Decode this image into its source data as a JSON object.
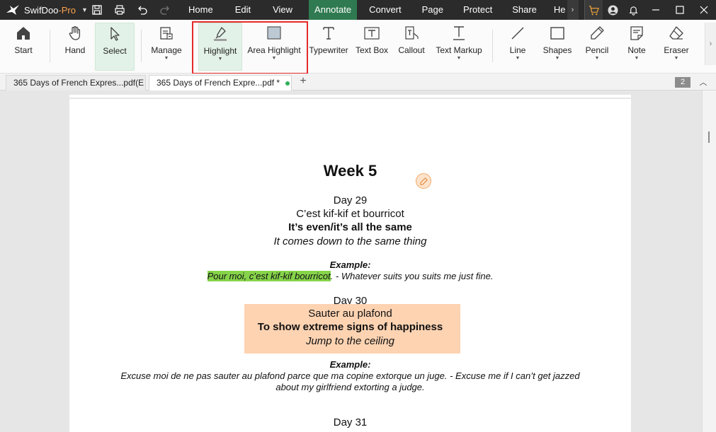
{
  "app": {
    "name": "SwifDoo",
    "edition": "-Pro"
  },
  "menu": {
    "items": [
      "Home",
      "Edit",
      "View",
      "Annotate",
      "Convert",
      "Page",
      "Protect",
      "Share",
      "He"
    ],
    "active": "Annotate",
    "active_color": "#2f7a50"
  },
  "ribbon": {
    "start": "Start",
    "hand": "Hand",
    "select": "Select",
    "manage": "Manage",
    "highlight": "Highlight",
    "area_highlight": "Area Highlight",
    "typewriter": "Typewriter",
    "text_box": "Text Box",
    "callout": "Callout",
    "text_markup": "Text Markup",
    "line": "Line",
    "shapes": "Shapes",
    "pencil": "Pencil",
    "note": "Note",
    "eraser": "Eraser",
    "callout_box_color": "#e52a2a"
  },
  "tabs": {
    "items": [
      "365 Days of French Expres...pdf(E",
      "365 Days of French Expre...pdf *"
    ],
    "active_index": 1,
    "page_count": "2"
  },
  "document": {
    "week_title": "Week 5",
    "day29": {
      "day": "Day 29",
      "french": "C’est kif-kif et bourricot",
      "english": "It’s even/it’s all the same",
      "meaning": "It comes down to the same thing",
      "example_label": "Example:",
      "example_highlighted": "Pour moi, c’est kif-kif bourricot",
      "example_rest": ". - Whatever suits you suits me just fine."
    },
    "day30": {
      "day": "Day 30",
      "french": "Sauter au plafond",
      "english": "To show extreme signs of happiness",
      "meaning": "Jump to the ceiling",
      "example_label": "Example:",
      "example_line1": "Excuse moi de ne pas sauter au plafond parce que ma copine extorque un juge. - Excuse me if I can’t get jazzed",
      "example_line2": "about my girlfriend extorting a judge."
    },
    "day31": {
      "day": "Day 31"
    },
    "highlight_color": "#86d34a",
    "area_highlight_color": "#fdd3b2"
  }
}
